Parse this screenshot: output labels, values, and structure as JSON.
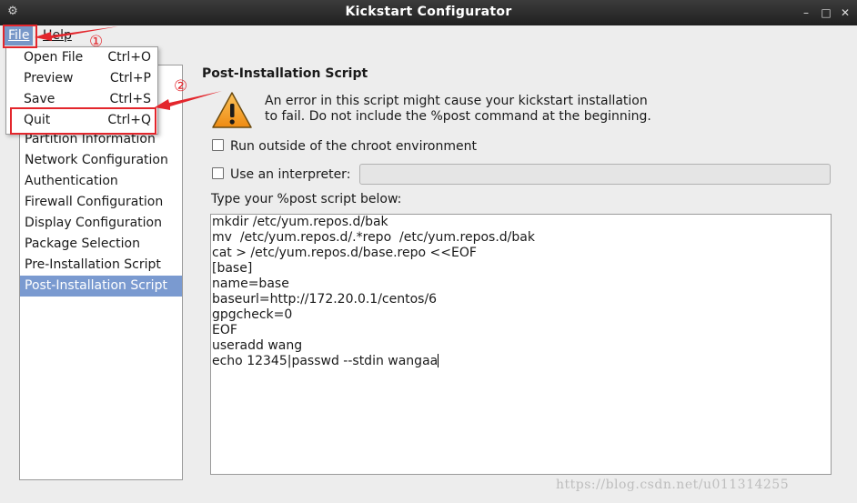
{
  "window": {
    "title": "Kickstart Configurator"
  },
  "menubar": {
    "items": [
      {
        "label": "File"
      },
      {
        "label": "Help"
      }
    ]
  },
  "file_menu": {
    "items": [
      {
        "label": "Open File",
        "accel": "Ctrl+O"
      },
      {
        "label": "Preview",
        "accel": "Ctrl+P"
      },
      {
        "label": "Save",
        "accel": "Ctrl+S"
      },
      {
        "label": "Quit",
        "accel": "Ctrl+Q"
      }
    ]
  },
  "sidebar": {
    "items": [
      {
        "label": "Partition Information"
      },
      {
        "label": "Network Configuration"
      },
      {
        "label": "Authentication"
      },
      {
        "label": "Firewall Configuration"
      },
      {
        "label": "Display Configuration"
      },
      {
        "label": "Package Selection"
      },
      {
        "label": "Pre-Installation Script"
      },
      {
        "label": "Post-Installation Script",
        "selected": true
      }
    ]
  },
  "main": {
    "section_title": "Post-Installation Script",
    "warning_line1": "An error in this script might cause your kickstart installation",
    "warning_line2": "to fail. Do not include the %post command at the beginning.",
    "chroot_label": "Run outside of the chroot environment",
    "chroot_checked": false,
    "interpreter_label": "Use an interpreter:",
    "interpreter_checked": false,
    "interpreter_value": "",
    "prompt": "Type your %post script below:",
    "script_lines": [
      "mkdir /etc/yum.repos.d/bak",
      "mv  /etc/yum.repos.d/.*repo  /etc/yum.repos.d/bak",
      "cat > /etc/yum.repos.d/base.repo <<EOF",
      "[base]",
      "name=base",
      "baseurl=http://172.20.0.1/centos/6",
      "gpgcheck=0",
      "EOF",
      "useradd wang",
      "echo 12345|passwd --stdin wangaa"
    ]
  },
  "annotations": {
    "step1": "①",
    "step2": "②"
  },
  "watermark": "https://blog.csdn.net/u011314255",
  "colors": {
    "accent": "#7a9ad0",
    "annotation": "#e3262c",
    "titlebar": "#2b2b2b",
    "warning": "#f39b1e"
  },
  "icons": {
    "app": "gear-window-icon",
    "minimize": "minimize-icon",
    "maximize": "maximize-icon",
    "close": "close-icon",
    "warning": "warning-triangle-icon"
  }
}
